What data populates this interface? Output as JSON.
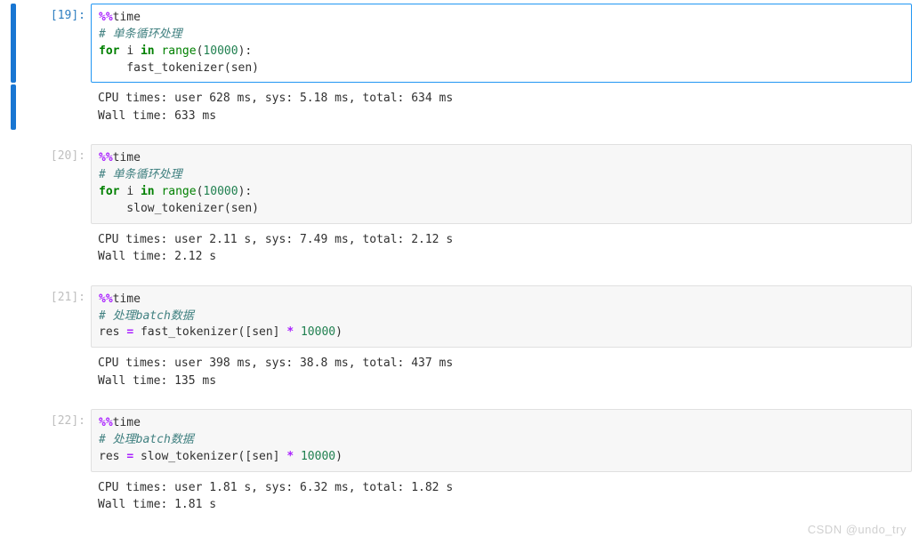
{
  "cells": [
    {
      "exec": "19",
      "selected": true,
      "code": {
        "magic": "%%",
        "magic_name": "time",
        "comment": "# 单条循环处理",
        "for_kw": "for",
        "var": "i",
        "in_kw": "in",
        "range_fn": "range",
        "range_arg": "10000",
        "call_line": "    fast_tokenizer(sen)"
      },
      "output": "CPU times: user 628 ms, sys: 5.18 ms, total: 634 ms\nWall time: 633 ms"
    },
    {
      "exec": "20",
      "selected": false,
      "code": {
        "magic": "%%",
        "magic_name": "time",
        "comment": "# 单条循环处理",
        "for_kw": "for",
        "var": "i",
        "in_kw": "in",
        "range_fn": "range",
        "range_arg": "10000",
        "call_line": "    slow_tokenizer(sen)"
      },
      "output": "CPU times: user 2.11 s, sys: 7.49 ms, total: 2.12 s\nWall time: 2.12 s"
    },
    {
      "exec": "21",
      "selected": false,
      "code_batch": {
        "magic": "%%",
        "magic_name": "time",
        "comment": "# 处理batch数据",
        "assign_pre": "res ",
        "op_eq": "=",
        "call_pre": " fast_tokenizer([sen] ",
        "op_mul": "*",
        "num": " 10000",
        "call_post": ")"
      },
      "output": "CPU times: user 398 ms, sys: 38.8 ms, total: 437 ms\nWall time: 135 ms"
    },
    {
      "exec": "22",
      "selected": false,
      "code_batch": {
        "magic": "%%",
        "magic_name": "time",
        "comment": "# 处理batch数据",
        "assign_pre": "res ",
        "op_eq": "=",
        "call_pre": " slow_tokenizer([sen] ",
        "op_mul": "*",
        "num": " 10000",
        "call_post": ")"
      },
      "output": "CPU times: user 1.81 s, sys: 6.32 ms, total: 1.82 s\nWall time: 1.81 s"
    }
  ],
  "watermark": "CSDN @undo_try"
}
